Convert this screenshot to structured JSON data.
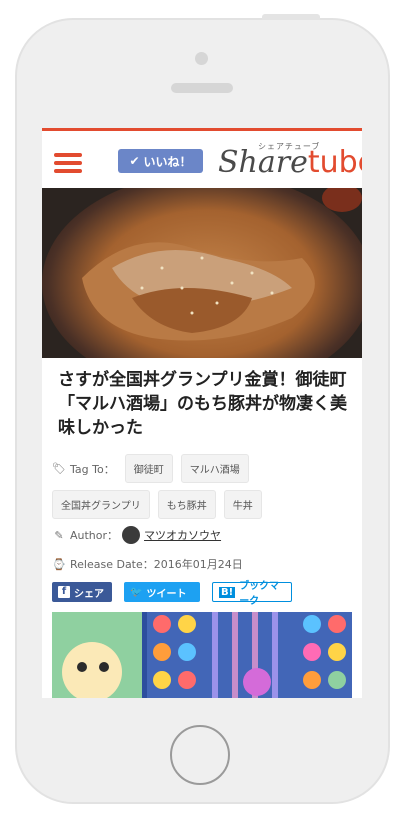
{
  "header": {
    "like_label": "いいね！",
    "logo_text": "Share",
    "logo_accent": "tube",
    "logo_kana": "シェアチューブ"
  },
  "article": {
    "title": "さすが全国丼グランプリ金賞！御徒町「マルハ酒場」のもち豚丼が物凄く美味しかった",
    "tag_label": "Tag To：",
    "tags": [
      "御徒町",
      "マルハ酒場",
      "全国丼グランプリ",
      "もち豚丼",
      "牛丼"
    ],
    "author_label": "Author：",
    "author_name": "マツオカソウヤ",
    "release_label": "Release Date：2016年01月24日"
  },
  "share": {
    "facebook": "シェア",
    "twitter": "ツイート",
    "hatena": "ブックマーク",
    "hatena_icon": "B!"
  },
  "colors": {
    "accent": "#e24b2f",
    "like": "#6b86c8",
    "facebook": "#3b5998",
    "twitter": "#1da1f2",
    "hatena": "#008fde"
  }
}
